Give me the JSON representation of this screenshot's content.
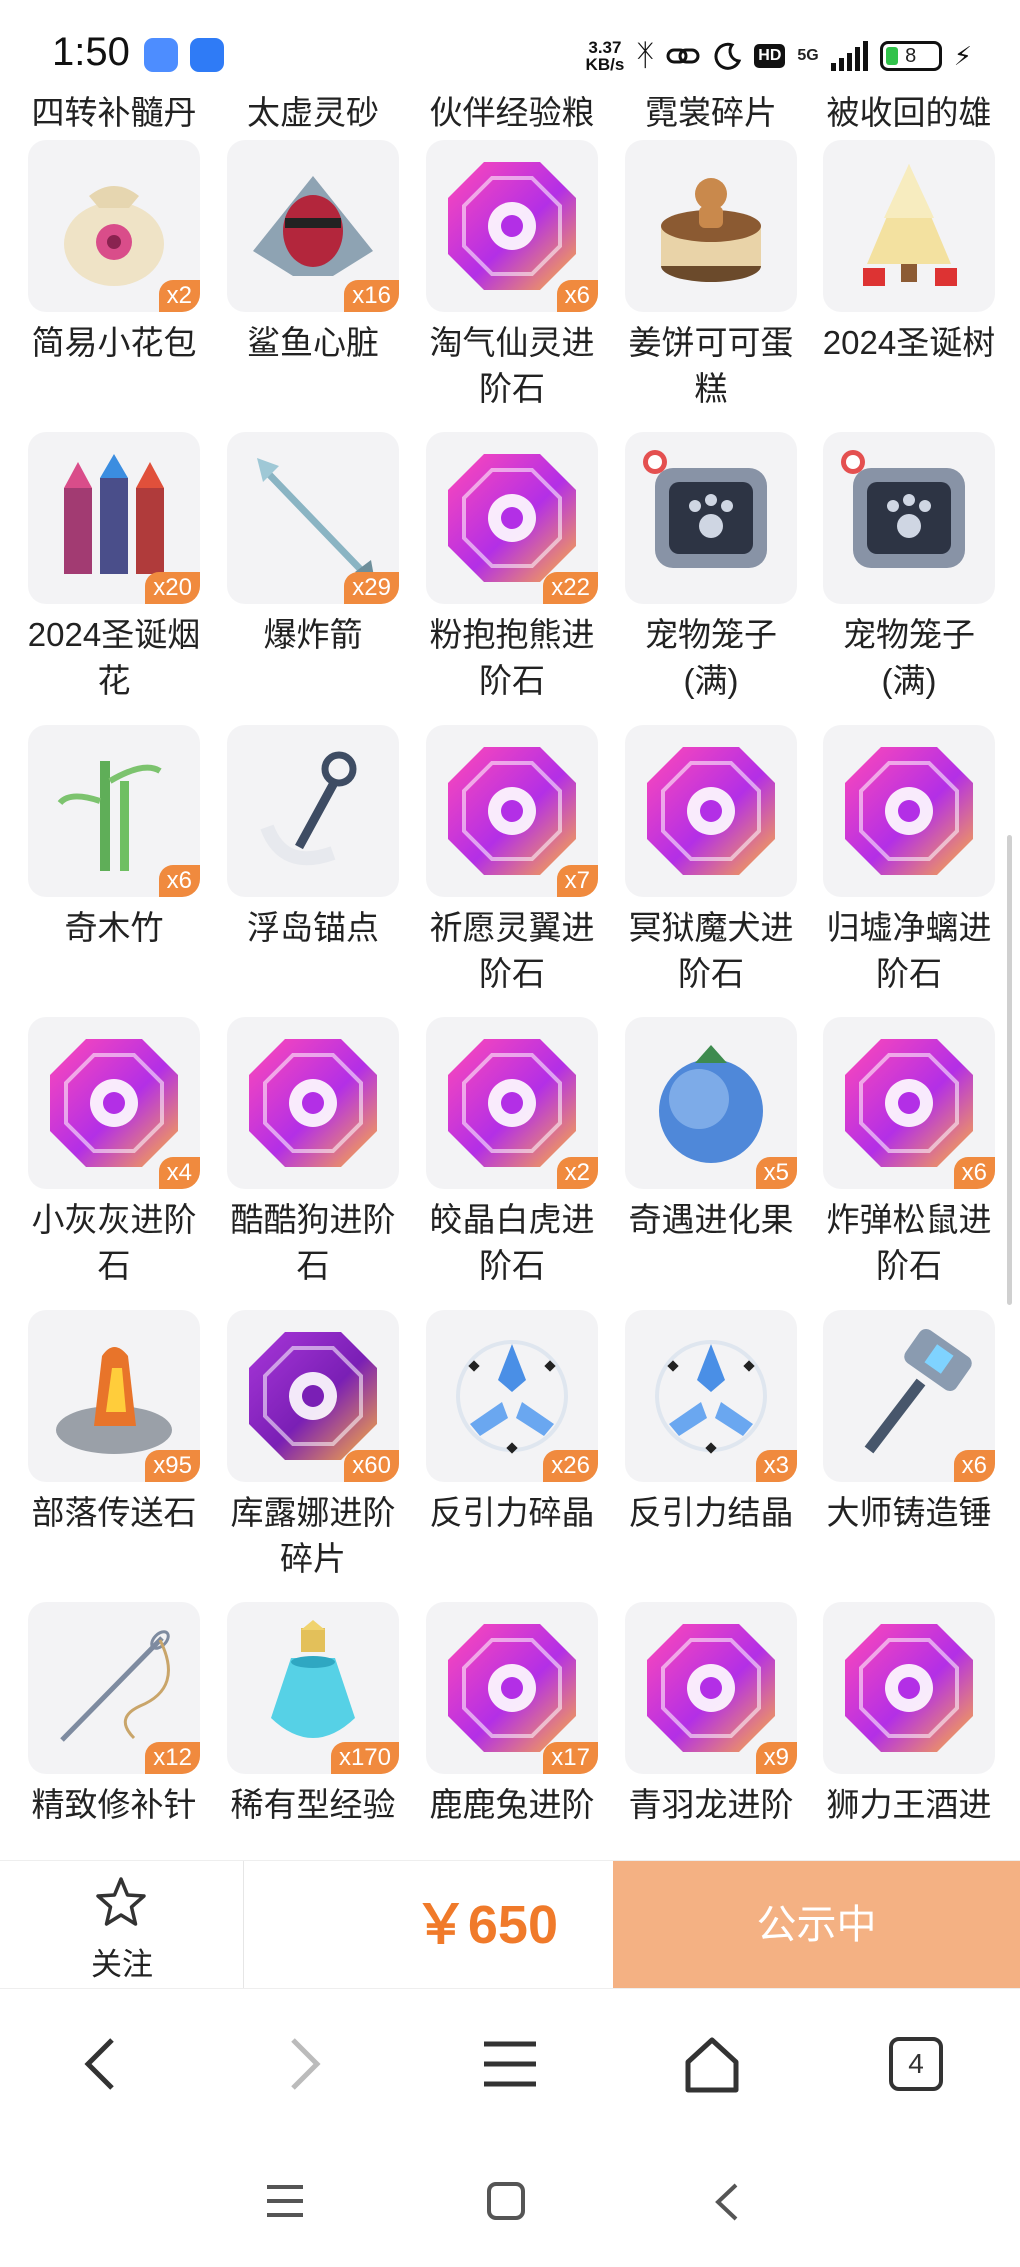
{
  "status_bar": {
    "time": "1:50",
    "net_speed_value": "3.37",
    "net_speed_unit": "KB/s",
    "hd_label": "HD",
    "network_label": "5G",
    "battery_level": "8"
  },
  "top_row_labels": [
    "四转补髓丹",
    "太虚灵砂",
    "伙伴经验粮",
    "霓裳碎片",
    "被收回的雄\n文号"
  ],
  "items": [
    {
      "label": "简易小花包",
      "count": "x2",
      "icon": "flower-bag-icon"
    },
    {
      "label": "鲨鱼心脏",
      "count": "x16",
      "icon": "shark-heart-icon"
    },
    {
      "label": "淘气仙灵进\n阶石",
      "count": "x6",
      "icon": "gem-fairy-icon"
    },
    {
      "label": "姜饼可可蛋\n糕",
      "count": "",
      "icon": "gingerbread-cake-icon"
    },
    {
      "label": "2024圣诞树",
      "count": "",
      "icon": "christmas-tree-icon"
    },
    {
      "label": "2024圣诞烟\n花",
      "count": "x20",
      "icon": "fireworks-icon"
    },
    {
      "label": "爆炸箭",
      "count": "x29",
      "icon": "arrow-icon"
    },
    {
      "label": "粉抱抱熊进\n阶石",
      "count": "x22",
      "icon": "gem-egg-icon"
    },
    {
      "label": "宠物笼子\n(满)",
      "count": "",
      "icon": "pet-cage-icon"
    },
    {
      "label": "宠物笼子\n(满)",
      "count": "",
      "icon": "pet-cage-icon"
    },
    {
      "label": "奇木竹",
      "count": "x6",
      "icon": "bamboo-icon"
    },
    {
      "label": "浮岛锚点",
      "count": "",
      "icon": "anchor-icon"
    },
    {
      "label": "祈愿灵翼进\n阶石",
      "count": "x7",
      "icon": "gem-wing-icon"
    },
    {
      "label": "冥狱魔犬进\n阶石",
      "count": "",
      "icon": "gem-swirl-icon"
    },
    {
      "label": "归墟净螭进\n阶石",
      "count": "",
      "icon": "gem-dragon-icon"
    },
    {
      "label": "小灰灰进阶\n石",
      "count": "x4",
      "icon": "gem-lollipop-icon"
    },
    {
      "label": "酷酷狗进阶\n石",
      "count": "",
      "icon": "gem-dog-icon"
    },
    {
      "label": "皎晶白虎进\n阶石",
      "count": "x2",
      "icon": "gem-claw-icon"
    },
    {
      "label": "奇遇进化果",
      "count": "x5",
      "icon": "evolution-fruit-icon"
    },
    {
      "label": "炸弹松鼠进\n阶石",
      "count": "x6",
      "icon": "gem-acorn-icon"
    },
    {
      "label": "部落传送石",
      "count": "x95",
      "icon": "teleport-stone-icon"
    },
    {
      "label": "库露娜进阶\n碎片",
      "count": "x60",
      "icon": "gem-octopus-icon"
    },
    {
      "label": "反引力碎晶",
      "count": "x26",
      "icon": "antigravity-shard-icon"
    },
    {
      "label": "反引力结晶",
      "count": "x3",
      "icon": "antigravity-crystal-icon"
    },
    {
      "label": "大师铸造锤",
      "count": "x6",
      "icon": "hammer-icon"
    },
    {
      "label": "精致修补针",
      "count": "x12",
      "icon": "needle-icon"
    },
    {
      "label": "稀有型经验",
      "count": "x170",
      "icon": "potion-icon"
    },
    {
      "label": "鹿鹿兔进阶",
      "count": "x17",
      "icon": "gem-carrot-icon"
    },
    {
      "label": "青羽龙进阶",
      "count": "x9",
      "icon": "gem-beast-icon"
    },
    {
      "label": "狮力王酒进",
      "count": "",
      "icon": "gem-mask-icon"
    }
  ],
  "action_bar": {
    "follow_label": "关注",
    "price": "￥650",
    "status_button": "公示中"
  },
  "browser_nav": {
    "tabs_count": "4"
  },
  "colors": {
    "badge": "#f08a3e",
    "price": "#f07a2a",
    "status_button": "#f4b183"
  }
}
